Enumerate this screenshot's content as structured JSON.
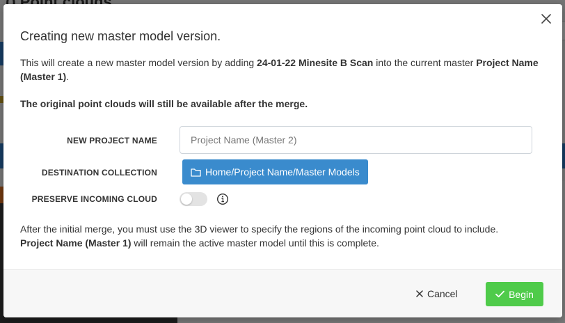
{
  "background": {
    "page_title": "Point clouds"
  },
  "modal": {
    "title": "Creating new master model version.",
    "intro": {
      "prefix": "This will create a new master model version by adding ",
      "source_cloud": "24-01-22 Minesite B Scan",
      "middle": " into the current master ",
      "current_master": "Project Name (Master 1)",
      "suffix": "."
    },
    "note": "The original point clouds will still be available after the merge.",
    "form": {
      "new_project_name_label": "NEW PROJECT NAME",
      "new_project_name_placeholder": "Project Name (Master 2)",
      "new_project_name_value": "",
      "destination_label": "DESTINATION COLLECTION",
      "destination_value": "Home/Project Name/Master Models",
      "preserve_label": "PRESERVE INCOMING CLOUD",
      "preserve_enabled": false
    },
    "after": {
      "line1": "After the initial merge, you must use the 3D viewer to specify the regions of the incoming point cloud to include.",
      "bold": "Project Name (Master 1)",
      "line2": " will remain the active master model until this is complete."
    },
    "footer": {
      "cancel_label": "Cancel",
      "begin_label": "Begin"
    }
  },
  "colors": {
    "primary_blue": "#3a8bcd",
    "success_green": "#4fcb4a",
    "overlay": "rgba(0,0,0,0.5)"
  },
  "icons": {
    "close": "close-icon",
    "folder": "folder-icon",
    "info": "info-icon",
    "cancel": "x-icon",
    "begin": "check-icon"
  }
}
